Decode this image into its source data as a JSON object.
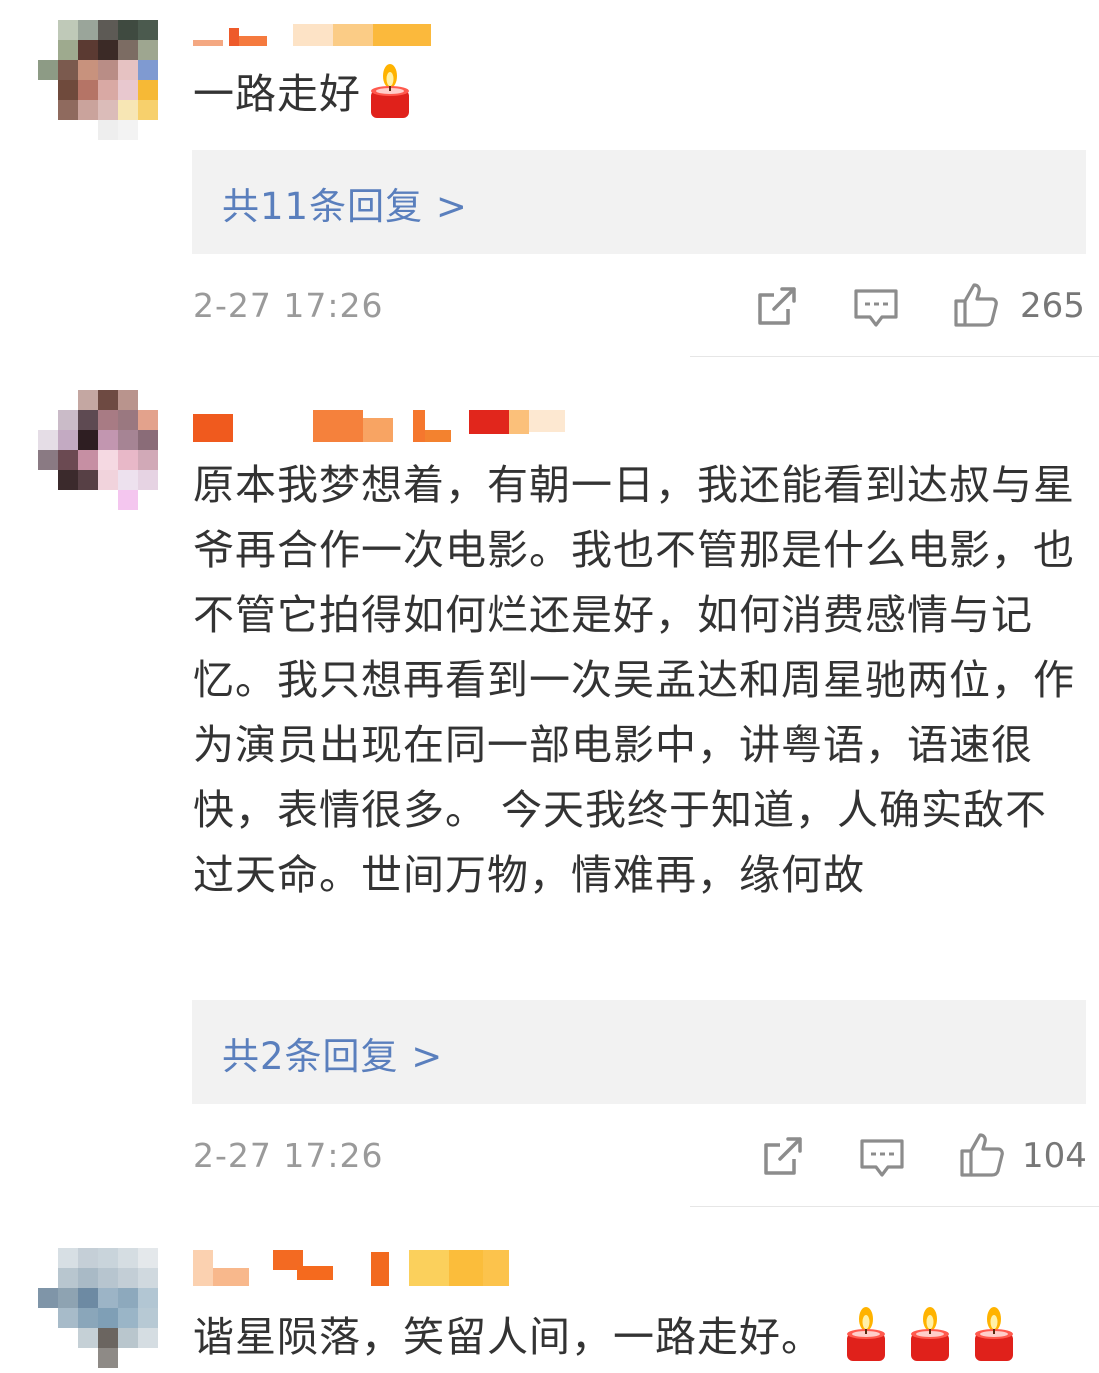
{
  "comments": [
    {
      "text": "一路走好",
      "replies": "共11条回复 >",
      "time": "2-27 17:26",
      "likes": "265",
      "candles": 1
    },
    {
      "text": "原本我梦想着，有朝一日，我还能看到达叔与星爷再合作一次电影。我也不管那是什么电影，也不管它拍得如何烂还是好，如何消费感情与记忆。我只想再看到一次吴孟达和周星驰两位，作为演员出现在同一部电影中，讲粤语，语速很快，表情很多。 今天我终于知道，人确实敌不过天命。世间万物，情难再，缘何故",
      "replies": "共2条回复 >",
      "time": "2-27 17:26",
      "likes": "104",
      "candles": 0
    },
    {
      "text": "谐星陨落，笑留人间，一路走好。",
      "candles": 3
    }
  ],
  "icons": {
    "share": "share-icon",
    "comment": "comment-icon",
    "like": "thumbs-up-icon",
    "emoji": "candle-emoji-icon"
  },
  "colors": {
    "reply_link": "#5a7fbd",
    "reply_bg": "#f2f2f2",
    "meta_text": "#9a9a9a",
    "icon_stroke": "#8c8c8c",
    "candle_red": "#e0211b",
    "flame_yellow": "#ffb300"
  }
}
